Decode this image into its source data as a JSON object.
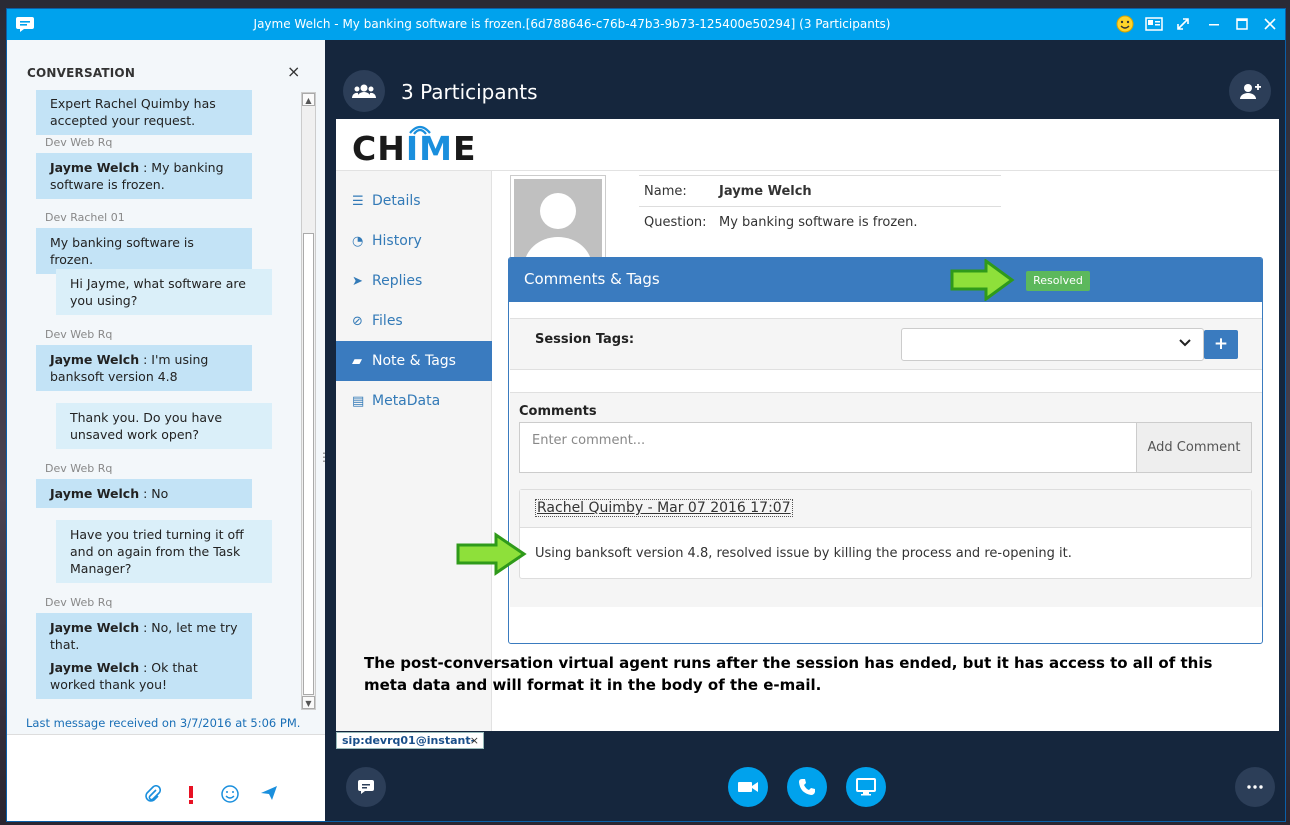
{
  "window": {
    "title": "Jayme Welch - My banking software is frozen.[6d788646-c76b-47b3-9b73-125400e50294] (3 Participants)"
  },
  "conversation": {
    "heading": "CONVERSATION",
    "close_glyph": "×",
    "messages": [
      {
        "text_plain": "Expert Rachel Quimby has accepted your request."
      },
      {
        "sender": "Dev Web Rq",
        "name": "Jayme Welch",
        "text": " : My banking software is frozen."
      },
      {
        "sender": "Dev Rachel 01",
        "text_plain": "My banking software is frozen."
      },
      {
        "text_plain": "Hi Jayme, what software are you using?"
      },
      {
        "sender": "Dev Web Rq",
        "name": "Jayme Welch",
        "text": " : I'm using banksoft version 4.8"
      },
      {
        "text_plain": "Thank you. Do you have unsaved work open?"
      },
      {
        "sender": "Dev Web Rq",
        "name": "Jayme Welch",
        "text": " : No"
      },
      {
        "text_plain": "Have you tried turning it off and on again from the Task Manager?"
      },
      {
        "sender": "Dev Web Rq",
        "name": "Jayme Welch",
        "text": " : No, let me try that.",
        "name2": "Jayme Welch",
        "text2": " : Ok that worked thank you!"
      }
    ],
    "last_message": "Last message received on 3/7/2016 at 5:06 PM."
  },
  "main": {
    "participants_title": "3 Participants",
    "sip_tab": "sip:devrq01@instant-",
    "sip_close": "×"
  },
  "web": {
    "logo": {
      "prefix": "CH",
      "accent": "I",
      "m": "M",
      "suffix": "E"
    },
    "nav": [
      {
        "label": "Details",
        "icon": "list-icon"
      },
      {
        "label": "History",
        "icon": "history-icon"
      },
      {
        "label": "Replies",
        "icon": "send-icon"
      },
      {
        "label": "Files",
        "icon": "paperclip-icon"
      },
      {
        "label": "Note & Tags",
        "icon": "comment-icon",
        "active": true
      },
      {
        "label": "MetaData",
        "icon": "table-icon"
      }
    ],
    "info": {
      "name_label": "Name:",
      "name_value": "Jayme Welch",
      "question_label": "Question:",
      "question_value": "My banking software is frozen."
    },
    "panel": {
      "title": "Comments & Tags",
      "status_badge": "Resolved",
      "session_tags_label": "Session Tags:",
      "plus_glyph": "+",
      "comments_label": "Comments",
      "comment_placeholder": "Enter comment...",
      "add_comment_label": "Add Comment",
      "comment_header": "Rachel Quimby - Mar 07 2016 17:07",
      "comment_body": "Using banksoft version 4.8, resolved issue by killing the process and re-opening it."
    },
    "note": "The post-conversation virtual agent runs after the session has ended, but it has access to all of this meta data and will format it in the body of the e-mail."
  },
  "colors": {
    "titlebar": "#00a2ed",
    "panel_header": "#3a7bbf",
    "badge": "#5cb85c",
    "arrow": "#7ed321",
    "dark_bg": "#15263d"
  }
}
